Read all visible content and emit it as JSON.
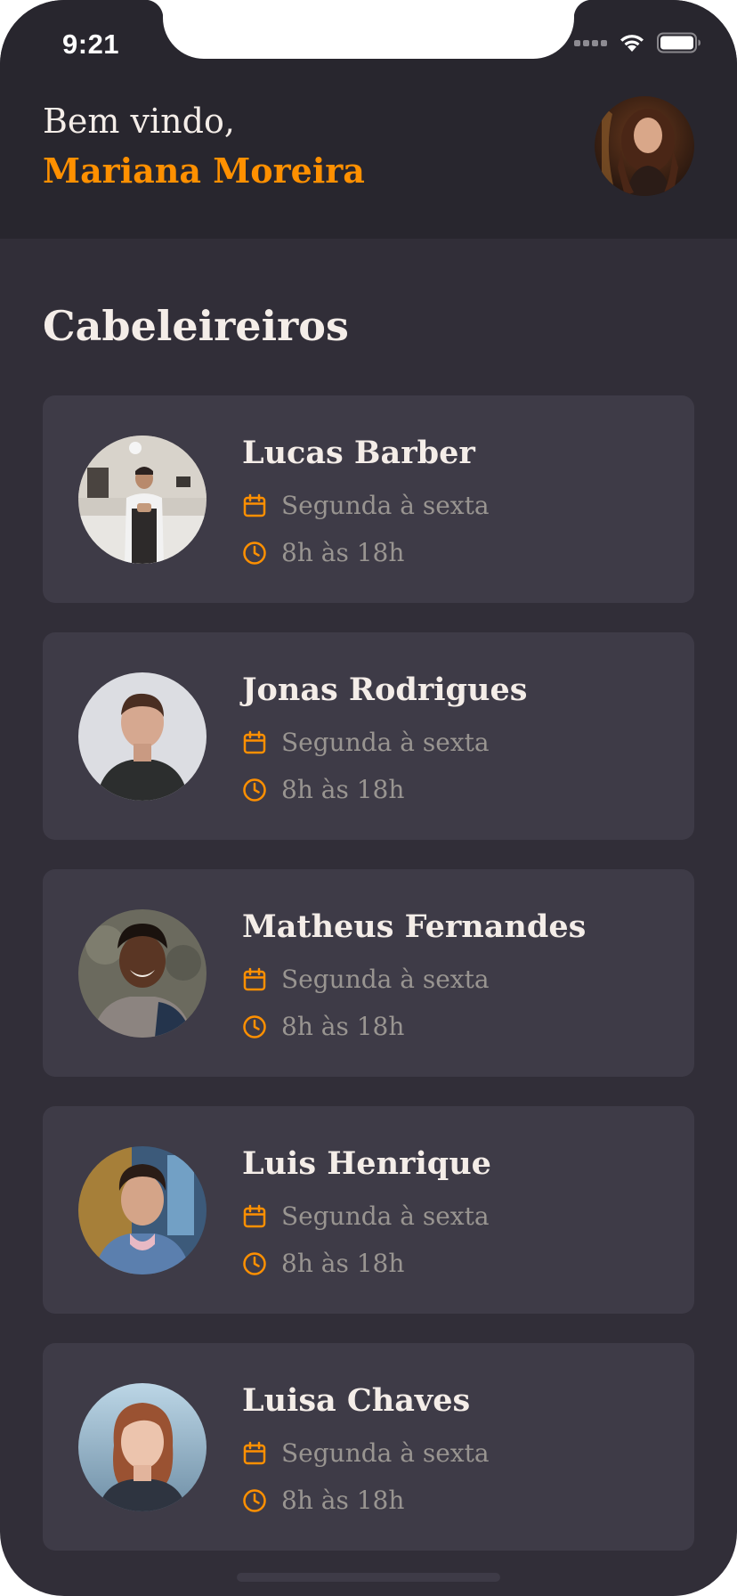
{
  "status_bar": {
    "time": "9:21",
    "icons": [
      "signal-icon",
      "wifi-icon",
      "battery-icon"
    ]
  },
  "header": {
    "greeting": "Bem vindo,",
    "user_name": "Mariana Moreira",
    "avatar_icon": "user-avatar"
  },
  "section": {
    "title": "Cabeleireiros"
  },
  "providers": [
    {
      "name": "Lucas Barber",
      "days": "Segunda à sexta",
      "hours": "8h às 18h"
    },
    {
      "name": "Jonas Rodrigues",
      "days": "Segunda à sexta",
      "hours": "8h às 18h"
    },
    {
      "name": "Matheus Fernandes",
      "days": "Segunda à sexta",
      "hours": "8h às 18h"
    },
    {
      "name": "Luis Henrique",
      "days": "Segunda à sexta",
      "hours": "8h às 18h"
    },
    {
      "name": "Luisa Chaves",
      "days": "Segunda à sexta",
      "hours": "8h às 18h"
    }
  ],
  "colors": {
    "background": "#312e38",
    "header_background": "#28262e",
    "card_background": "#3e3b47",
    "accent": "#ff9000",
    "text_primary": "#f4ede8",
    "text_secondary": "#999591"
  }
}
